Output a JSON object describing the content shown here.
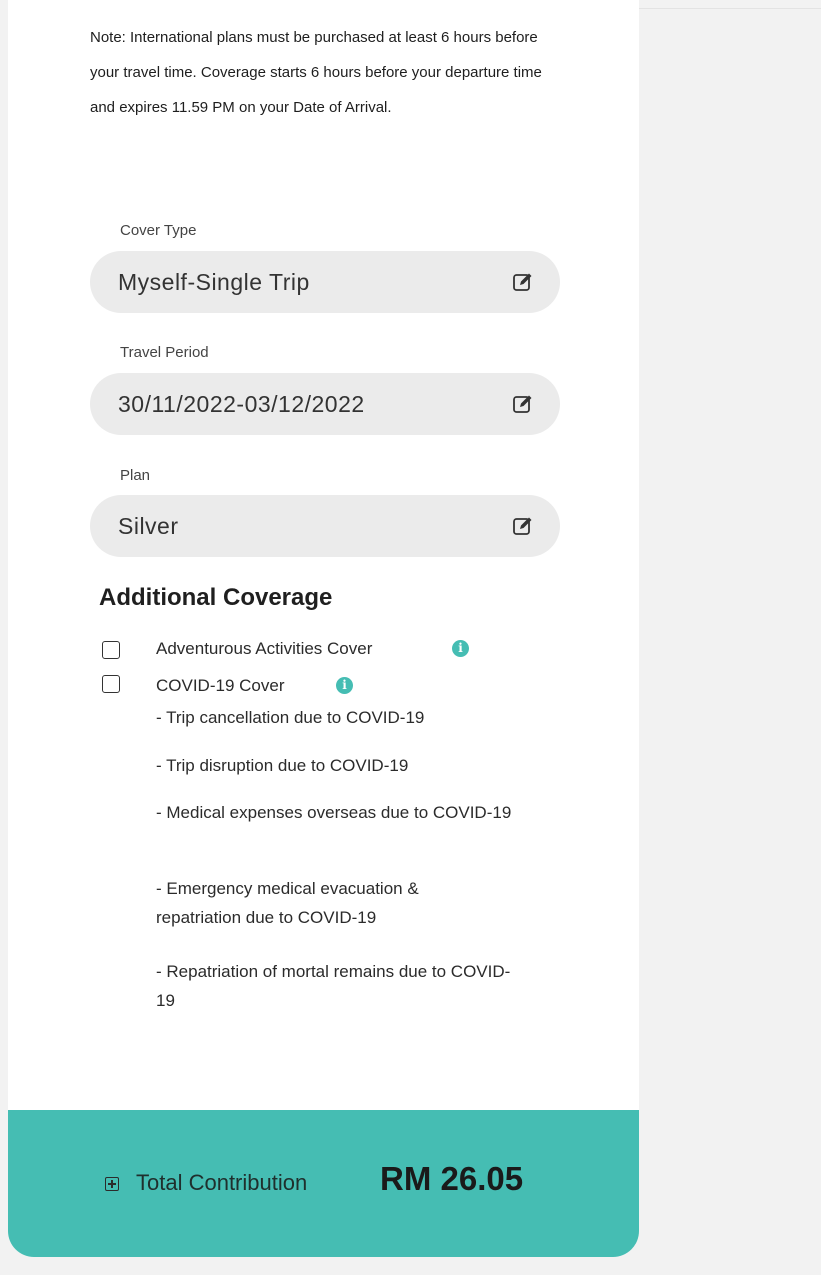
{
  "note": "Note: International plans must be purchased at least 6 hours before your travel time. Coverage starts 6 hours before your departure time and expires 11.59 PM on your Date of Arrival.",
  "fields": [
    {
      "label": "Cover Type",
      "value": "Myself-Single Trip",
      "icon": "edit-icon"
    },
    {
      "label": "Travel Period",
      "value": "30/11/2022-03/12/2022",
      "icon": "edit-icon"
    },
    {
      "label": "Plan",
      "value": "Silver",
      "icon": "edit-icon"
    }
  ],
  "additional_coverage": {
    "title": "Additional Coverage",
    "options": [
      {
        "label": "Adventurous Activities Cover",
        "checked": false,
        "info_icon": "info-icon"
      },
      {
        "label": "COVID-19 Cover",
        "checked": false,
        "info_icon": "info-icon"
      }
    ],
    "covid_details": [
      "- Trip cancellation due to COVID-19",
      "- Trip disruption due to COVID-19",
      "- Medical expenses overseas due to COVID-19",
      "- Emergency medical evacuation & repatriation due to COVID-19",
      "- Repatriation of mortal remains due to COVID-19"
    ]
  },
  "footer": {
    "total_label": "Total Contribution",
    "total_amount": "RM 26.05",
    "expand_icon": "plus-square-icon"
  },
  "colors": {
    "accent": "#45bdb3",
    "field_bg": "#ebebeb",
    "page_bg": "#f2f2f2"
  }
}
